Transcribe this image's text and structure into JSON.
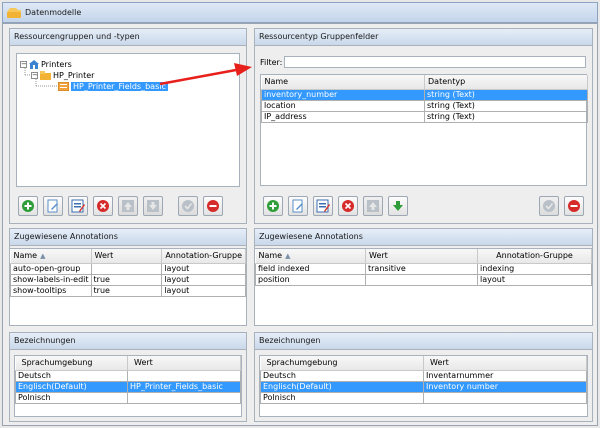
{
  "window": {
    "title": "Datenmodelle"
  },
  "resource_groups": {
    "title": "Ressourcengruppen und -typen",
    "tree": {
      "root": "Printers",
      "child": "HP_Printer",
      "leaf": "HP_Printer_Fields_basic"
    }
  },
  "group_fields": {
    "title": "Ressourcentyp Gruppenfelder",
    "filter_label": "Filter:",
    "filter_value": "",
    "columns": [
      "Name",
      "Datentyp"
    ],
    "rows": [
      [
        "inventory_number",
        "string (Text)"
      ],
      [
        "location",
        "string (Text)"
      ],
      [
        "IP_address",
        "string (Text)"
      ]
    ]
  },
  "annotations_left": {
    "title": "Zugewiesene Annotations",
    "columns": [
      "Name",
      "Wert",
      "Annotation-Gruppe"
    ],
    "rows": [
      [
        "auto-open-group",
        "",
        "layout"
      ],
      [
        "show-labels-in-edit",
        "true",
        "layout"
      ],
      [
        "show-tooltips",
        "true",
        "layout"
      ]
    ]
  },
  "annotations_right": {
    "title": "Zugewiesene Annotations",
    "columns": [
      "Name",
      "Wert",
      "Annotation-Gruppe"
    ],
    "rows": [
      [
        "field indexed",
        "transitive",
        "indexing"
      ],
      [
        "position",
        "",
        "layout"
      ]
    ]
  },
  "labels_left": {
    "title": "Bezeichnungen",
    "columns": [
      "Sprachumgebung",
      "Wert"
    ],
    "rows": [
      [
        "Deutsch",
        ""
      ],
      [
        "Englisch(Default)",
        "HP_Printer_Fields_basic"
      ],
      [
        "Polnisch",
        ""
      ]
    ]
  },
  "labels_right": {
    "title": "Bezeichnungen",
    "columns": [
      "Sprachumgebung",
      "Wert"
    ],
    "rows": [
      [
        "Deutsch",
        "Inventarnummer"
      ],
      [
        "Englisch(Default)",
        "Inventory number"
      ],
      [
        "Polnisch",
        ""
      ]
    ]
  },
  "icons": {
    "add": "add-icon",
    "edit": "edit-icon",
    "edit_table": "edit-table-icon",
    "delete": "delete-icon",
    "move_up": "arrow-up-icon",
    "move_down": "arrow-down-icon",
    "confirm": "check-icon",
    "remove": "remove-icon"
  },
  "colors": {
    "selection": "#3399ff",
    "arrow": "#e8201c"
  }
}
